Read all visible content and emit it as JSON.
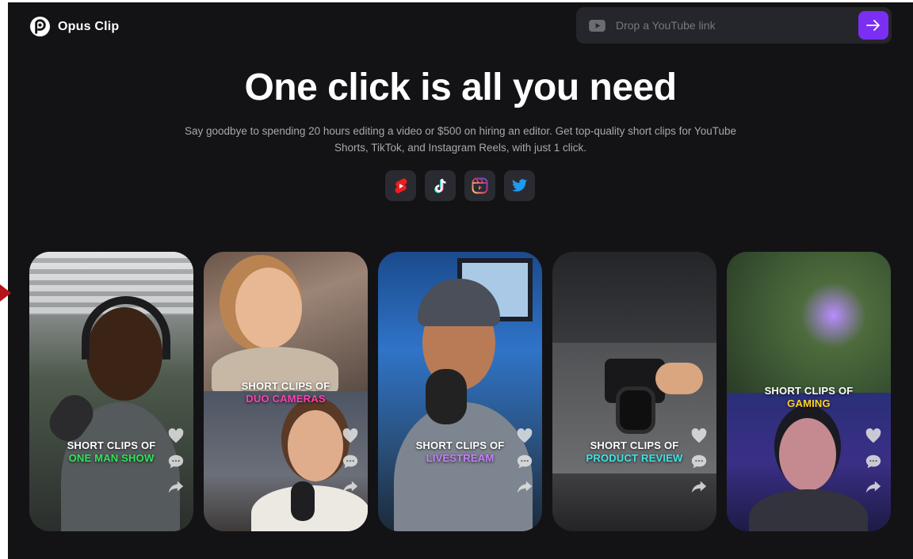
{
  "brand": {
    "name": "Opus Clip"
  },
  "search": {
    "placeholder": "Drop a YouTube link"
  },
  "hero": {
    "title": "One click is all you need",
    "subtitle": "Say goodbye to spending 20 hours editing a video or $500 on hiring an editor. Get top-quality short clips for YouTube Shorts, TikTok, and Instagram Reels, with just 1 click."
  },
  "socials": [
    {
      "name": "youtube-shorts-icon"
    },
    {
      "name": "tiktok-icon"
    },
    {
      "name": "instagram-reels-icon"
    },
    {
      "name": "twitter-icon"
    }
  ],
  "cards": [
    {
      "line1": "SHORT CLIPS OF",
      "line2": "ONE MAN SHOW",
      "accent": "#2ee65a"
    },
    {
      "line1": "SHORT CLIPS OF",
      "line2": "DUO CAMERAS",
      "accent": "#ff3fb4"
    },
    {
      "line1": "SHORT CLIPS OF",
      "line2": "LIVESTREAM",
      "accent": "#c77dff"
    },
    {
      "line1": "SHORT CLIPS OF",
      "line2": "PRODUCT REVIEW",
      "accent": "#3fe3e6"
    },
    {
      "line1": "SHORT CLIPS OF",
      "line2": "GAMING",
      "accent": "#ffd21f"
    }
  ],
  "colors": {
    "background": "#131316",
    "accent": "#7b2ff2",
    "input": "#25262b"
  }
}
